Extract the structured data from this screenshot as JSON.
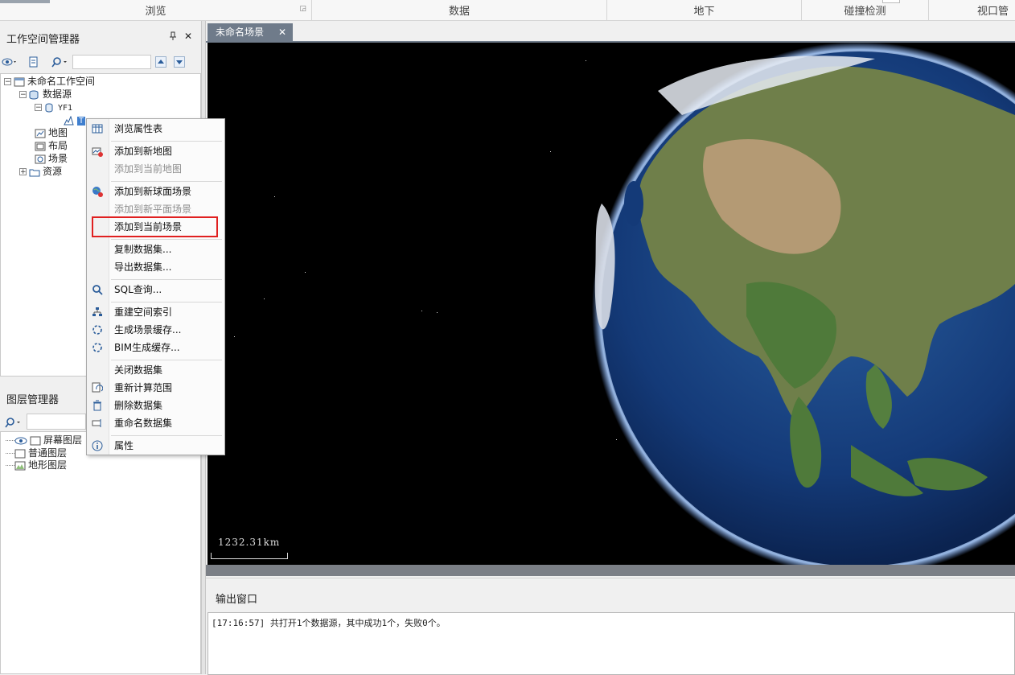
{
  "ribbon": {
    "groups": [
      "浏览",
      "数据",
      "地下",
      "碰撞检测",
      "视口管理"
    ]
  },
  "workspace_panel": {
    "title": "工作空间管理器",
    "pin_icon": "pin-icon",
    "close_label": "✕",
    "search_value": "",
    "tree": {
      "workspace": "未命名工作空间",
      "datasources": "数据源",
      "datasource_name": "YF1",
      "dataset_label": "T",
      "maps": "地图",
      "layouts": "布局",
      "scenes": "场景",
      "resources": "资源"
    }
  },
  "layer_panel": {
    "title": "图层管理器",
    "search_value": "",
    "layers": [
      "屏幕图层",
      "普通图层",
      "地形图层"
    ]
  },
  "scene_tab": {
    "label": "未命名场景",
    "close_label": "✕"
  },
  "scene": {
    "scale_label": "1232.31km"
  },
  "context_menu": {
    "items": [
      {
        "label": "浏览属性表",
        "icon": "attribute-table-icon",
        "enabled": true
      },
      {
        "label": "添加到新地图",
        "icon": "add-map-icon",
        "enabled": true
      },
      {
        "label": "添加到当前地图",
        "icon": "",
        "enabled": false
      },
      {
        "label": "添加到新球面场景",
        "icon": "globe-add-icon",
        "enabled": true
      },
      {
        "label": "添加到新平面场景",
        "icon": "",
        "enabled": false
      },
      {
        "label": "添加到当前场景",
        "icon": "",
        "enabled": true,
        "highlighted": true
      },
      {
        "label": "复制数据集...",
        "icon": "",
        "enabled": true
      },
      {
        "label": "导出数据集...",
        "icon": "",
        "enabled": true
      },
      {
        "label": "SQL查询...",
        "icon": "search-icon",
        "enabled": true
      },
      {
        "label": "重建空间索引",
        "icon": "spatial-index-icon",
        "enabled": true
      },
      {
        "label": "生成场景缓存...",
        "icon": "cache-icon",
        "enabled": true
      },
      {
        "label": "BIM生成缓存...",
        "icon": "cache-icon",
        "enabled": true
      },
      {
        "label": "关闭数据集",
        "icon": "",
        "enabled": true
      },
      {
        "label": "重新计算范围",
        "icon": "recalc-icon",
        "enabled": true
      },
      {
        "label": "删除数据集",
        "icon": "trash-icon",
        "enabled": true
      },
      {
        "label": "重命名数据集",
        "icon": "rename-icon",
        "enabled": true
      },
      {
        "label": "属性",
        "icon": "info-icon",
        "enabled": true
      }
    ]
  },
  "output_window": {
    "title": "输出窗口",
    "log": "[17:16:57] 共打开1个数据源，其中成功1个，失败0个。"
  },
  "colors": {
    "highlight_border": "#e02020",
    "tab_bg": "#6f7b8a",
    "scene_bg": "#000000"
  }
}
